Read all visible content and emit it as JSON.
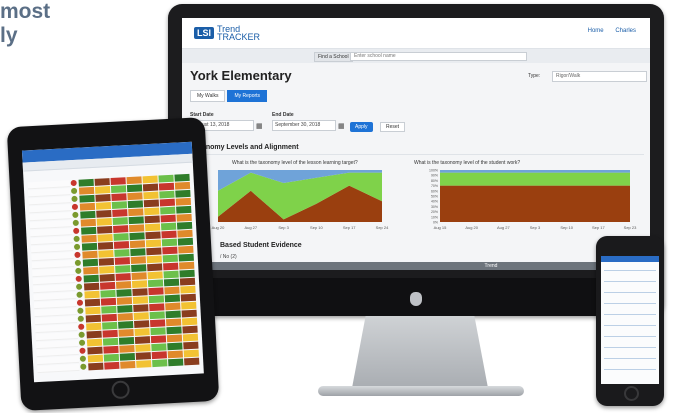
{
  "headline": {
    "line1": "most",
    "line2": "ly"
  },
  "desktop": {
    "logo_box": "LSI",
    "logo_text_1": "Trend",
    "logo_text_2": "TRACKER",
    "nav": [
      "Home",
      "Charles"
    ],
    "find_button": "Find a School",
    "search_placeholder": "Enter school name",
    "school_name": "York Elementary",
    "type_label": "Type:",
    "type_value": "Rigor/Walk",
    "tabs": [
      "My Walks",
      "My Reports"
    ],
    "start_date_label": "Start Date",
    "start_date": "August 13, 2018",
    "end_date_label": "End Date",
    "end_date": "September 30, 2018",
    "apply_label": "Apply",
    "reset_label": "Reset",
    "section_title": "Taxonomy Levels and Alignment",
    "chart_left_question": "What is the taxonomy level of the lesson learning target?",
    "chart_right_question": "What is the taxonomy level of the student work?",
    "evidence_title": "Based Student Evidence",
    "evidence_sub": "/ No (2)",
    "trend_label": "Trend"
  },
  "chart_data": [
    {
      "type": "area",
      "x": [
        "Aug 20",
        "Aug 27",
        "Sep 3",
        "Sep 10",
        "Sep 17",
        "Sep 24"
      ],
      "series": [
        {
          "color": "#9a3f0f",
          "values": [
            10,
            60,
            5,
            35,
            70,
            40
          ]
        },
        {
          "color": "#7fd24a",
          "values": [
            50,
            35,
            70,
            50,
            25,
            55
          ]
        },
        {
          "color": "#6fa3d9",
          "values": [
            40,
            5,
            25,
            15,
            5,
            5
          ]
        }
      ],
      "ylim": [
        0,
        100
      ]
    },
    {
      "type": "area",
      "x": [
        "Aug 15",
        "Aug 20",
        "Aug 27",
        "Sep 3",
        "Sep 10",
        "Sep 17",
        "Sep 23"
      ],
      "y_ticks": [
        "100%",
        "90%",
        "80%",
        "70%",
        "60%",
        "50%",
        "40%",
        "30%",
        "20%",
        "10%",
        "0%"
      ],
      "series": [
        {
          "color": "#9a3f0f",
          "values": [
            70,
            70,
            70,
            70,
            70,
            70,
            70
          ]
        },
        {
          "color": "#7fd24a",
          "values": [
            25,
            25,
            25,
            25,
            25,
            25,
            25
          ]
        },
        {
          "color": "#6fa3d9",
          "values": [
            5,
            5,
            5,
            5,
            5,
            5,
            5
          ]
        }
      ],
      "ylim": [
        0,
        100
      ]
    }
  ],
  "colors": {
    "brand": "#1b5ea8",
    "accent": "#1e73d6",
    "bar": "#6d747c"
  }
}
